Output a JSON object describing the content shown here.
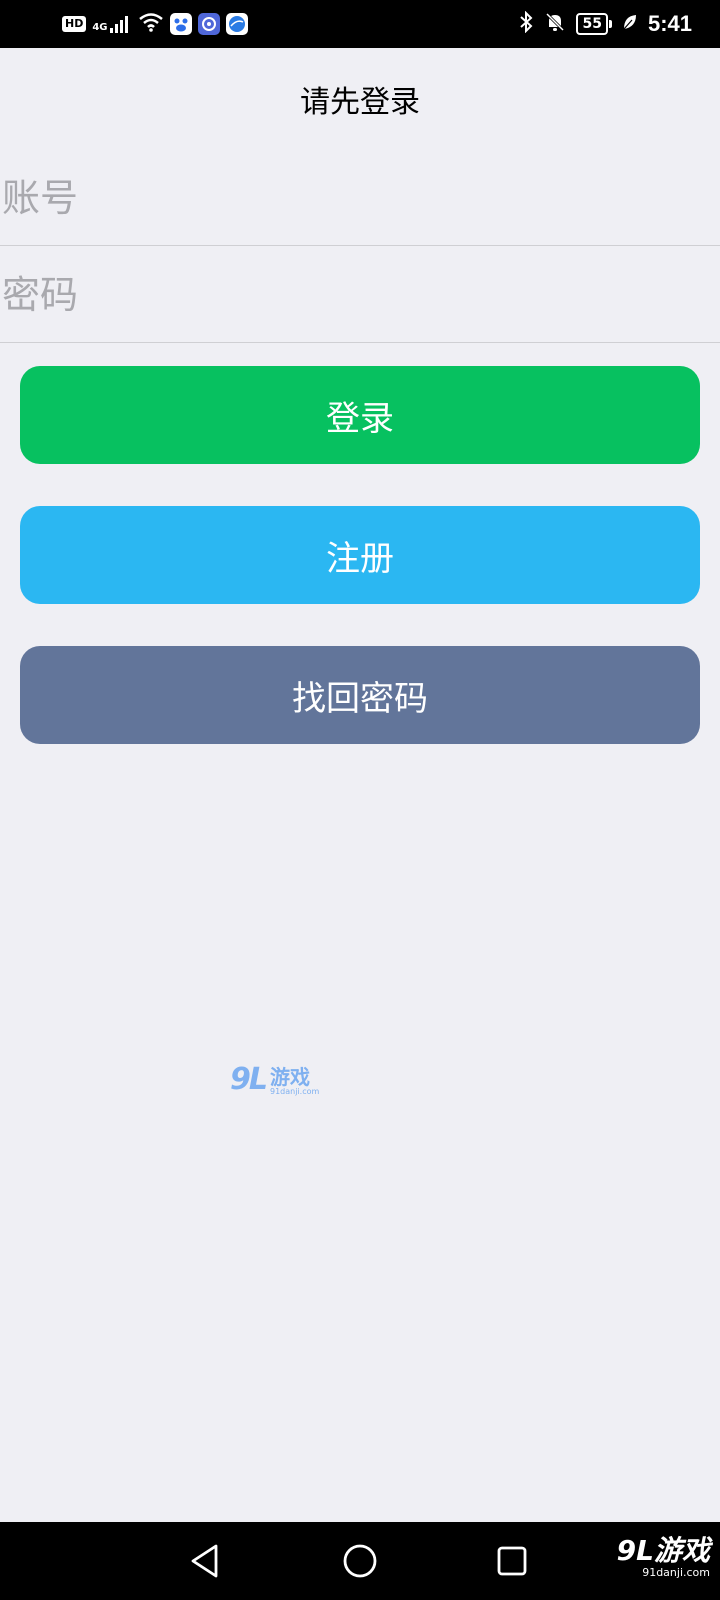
{
  "status_bar": {
    "hd_label": "HD",
    "network_label": "4G",
    "battery": "55",
    "time": "5:41",
    "left_icons": [
      "hd-icon",
      "signal-icon",
      "wifi-icon",
      "baidu-app-icon",
      "music-app-icon",
      "browser-app-icon"
    ],
    "right_icons": [
      "bluetooth-icon",
      "mute-bell-icon",
      "battery-icon",
      "leaf-icon"
    ]
  },
  "header": {
    "title": "请先登录"
  },
  "form": {
    "account_placeholder": "账号",
    "password_placeholder": "密码"
  },
  "buttons": {
    "login": "登录",
    "register": "注册",
    "forgot": "找回密码"
  },
  "colors": {
    "background": "#efeff4",
    "login": "#07c160",
    "register": "#2bb7f2",
    "forgot": "#62759a"
  },
  "watermark": {
    "logo": "9L",
    "text": "游戏",
    "url": "91danji.com"
  },
  "nav_bar": {
    "icons": [
      "back-triangle-icon",
      "home-circle-icon",
      "recent-square-icon"
    ]
  }
}
